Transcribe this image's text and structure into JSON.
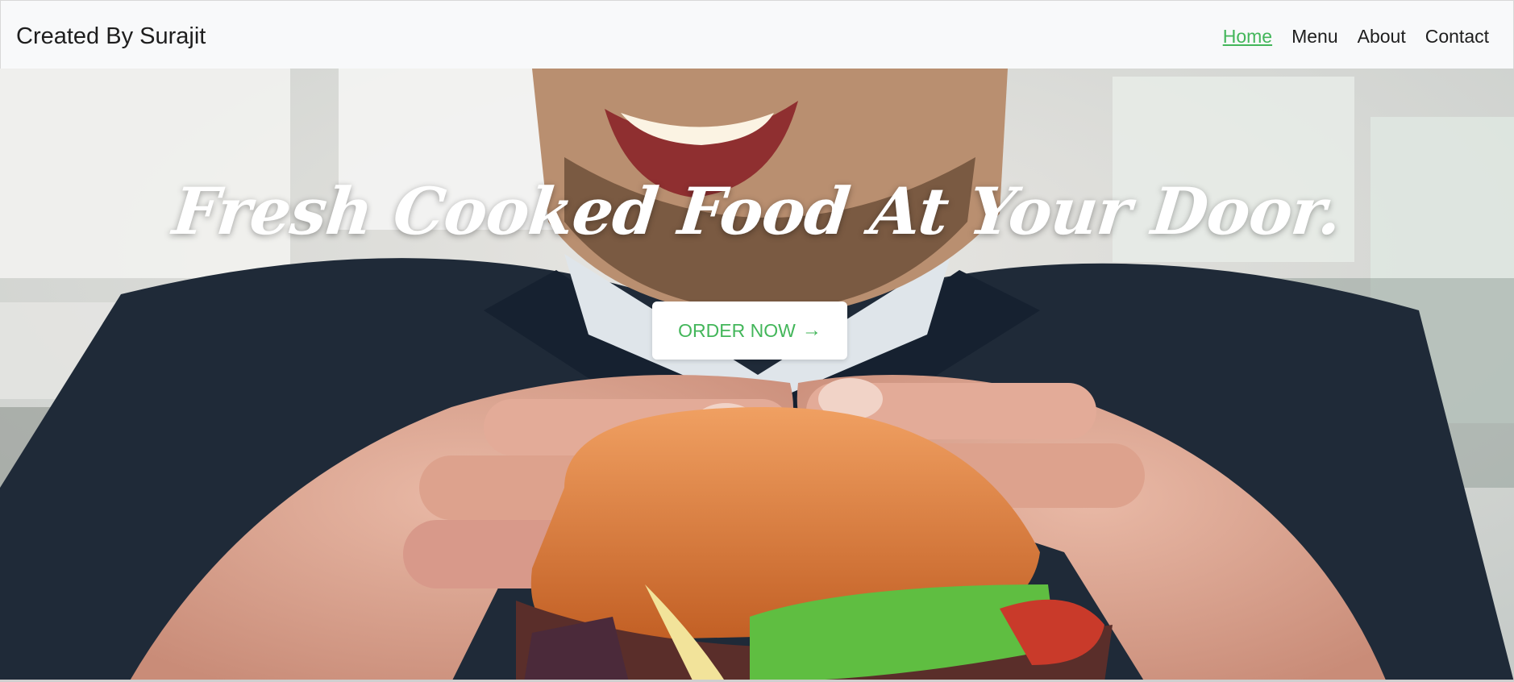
{
  "navbar": {
    "brand": "Created By Surajit",
    "links": [
      {
        "label": "Home",
        "active": true
      },
      {
        "label": "Menu",
        "active": false
      },
      {
        "label": "About",
        "active": false
      },
      {
        "label": "Contact",
        "active": false
      }
    ]
  },
  "hero": {
    "title": "Fresh Cooked Food At Your Door.",
    "cta_label": "ORDER NOW",
    "cta_icon": "arrow-right-icon",
    "image_subject": "man-eating-burger-photo"
  },
  "colors": {
    "accent": "#43b65a",
    "navbar_bg": "#f8f9fa",
    "text_dark": "#1e1e1e"
  }
}
